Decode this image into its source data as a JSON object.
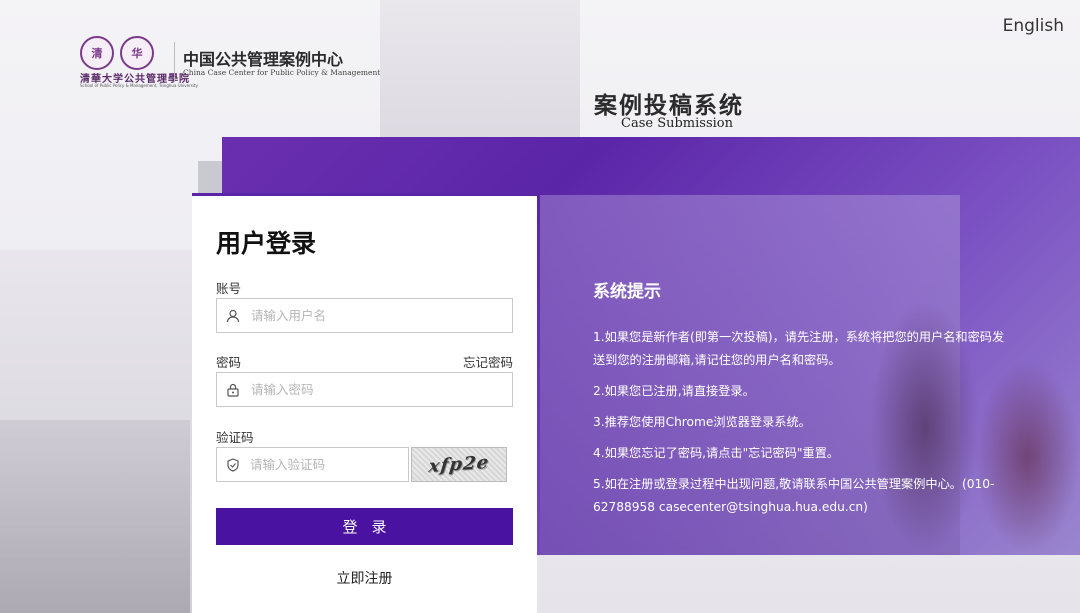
{
  "header": {
    "seal_1": "清",
    "seal_2": "华",
    "logo_script": "清華大学公共管理學院",
    "logo_script_sub": "School of Public Policy & Management, Tsinghua University",
    "org_name_cn": "中国公共管理案例中心",
    "org_name_en": "China Case Center for Public Policy & Management",
    "language_link": "English"
  },
  "system": {
    "title": "案例投稿系统",
    "subtitle": "Case Submission"
  },
  "login": {
    "title": "用户登录",
    "account_label": "账号",
    "account_placeholder": "请输入用户名",
    "password_label": "密码",
    "password_placeholder": "请输入密码",
    "forgot_password": "忘记密码",
    "captcha_label": "验证码",
    "captcha_placeholder": "请输入验证码",
    "captcha_text": "xfp2e",
    "login_button": "登录",
    "register_link": "立即注册"
  },
  "notice": {
    "title": "系统提示",
    "items": [
      "1.如果您是新作者(即第一次投稿)，请先注册，系统将把您的用户名和密码发送到您的注册邮箱,请记住您的用户名和密码。",
      "2.如果您已注册,请直接登录。",
      "3.推荐您使用Chrome浏览器登录系统。",
      "4.如果您忘记了密码,请点击\"忘记密码\"重置。",
      "5.如在注册或登录过程中出现问题,敬请联系中国公共管理案例中心。(010-62788958 casecenter@tsinghua.hua.edu.cn)"
    ]
  },
  "colors": {
    "brand_purple": "#4a12a0",
    "panel_purple": "#6a2fb0"
  },
  "icons": {
    "account": "user-icon",
    "password": "lock-icon",
    "captcha": "shield-icon"
  }
}
